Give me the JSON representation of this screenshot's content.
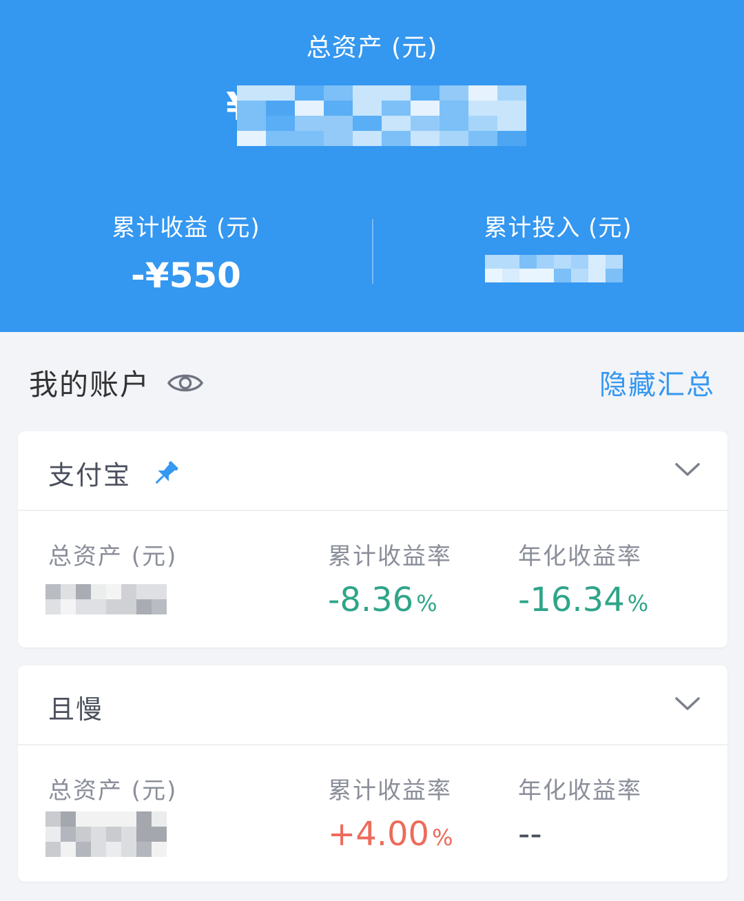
{
  "header": {
    "total_label": "总资产 (元)",
    "total_currency": "¥",
    "cumulative_gain_label": "累计收益 (元)",
    "cumulative_gain_value": "-¥550",
    "cumulative_input_label": "累计投入 (元)"
  },
  "section": {
    "title": "我的账户",
    "hide_summary": "隐藏汇总"
  },
  "accounts": [
    {
      "name": "支付宝",
      "pinned": true,
      "total_label": "总资产 (元)",
      "cumulative_rate_label": "累计收益率",
      "cumulative_rate_value": "-8.36",
      "cumulative_rate_unit": "%",
      "annual_rate_label": "年化收益率",
      "annual_rate_value": "-16.34",
      "annual_rate_unit": "%"
    },
    {
      "name": "且慢",
      "pinned": false,
      "total_label": "总资产 (元)",
      "cumulative_rate_label": "累计收益率",
      "cumulative_rate_value": "+4.00",
      "cumulative_rate_unit": "%",
      "annual_rate_label": "年化收益率",
      "annual_rate_value": "--"
    }
  ],
  "colors": {
    "header_bg": "#3497f0",
    "accent": "#3497f0",
    "negative": "#2fa588",
    "positive": "#ec6b5b"
  },
  "icons": [
    "eye-icon",
    "pin-icon",
    "chevron-down-icon"
  ]
}
